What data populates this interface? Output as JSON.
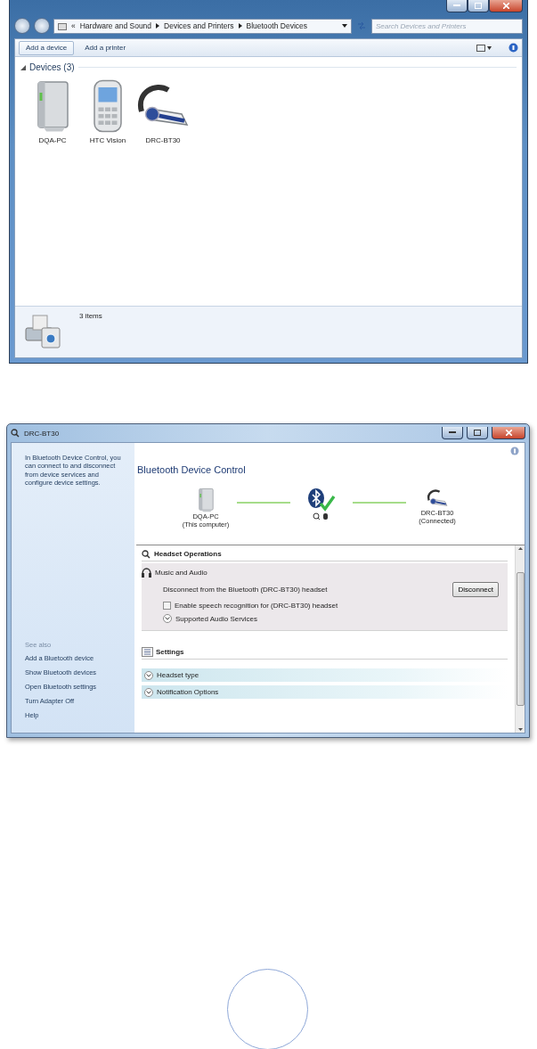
{
  "explorer": {
    "overflow": "«",
    "breadcrumb": [
      "Hardware and Sound",
      "Devices and Printers",
      "Bluetooth Devices"
    ],
    "search": {
      "placeholder": "Search Devices and Printers"
    },
    "toolbar": [
      {
        "label": "Add a device",
        "highlighted": true
      },
      {
        "label": "Add a printer",
        "highlighted": false
      }
    ],
    "group": {
      "label": "Devices (3)",
      "expanded": true
    },
    "devices": [
      {
        "name": "DQA-PC",
        "kind": "computer"
      },
      {
        "name": "HTC Vision",
        "kind": "phone"
      },
      {
        "name": "DRC-BT30",
        "kind": "headset"
      }
    ],
    "status": "3 items"
  },
  "control": {
    "title": "DRC-BT30",
    "intro": "In Bluetooth Device Control, you can connect to and disconnect from device services and configure device settings.",
    "see_also": "See also",
    "links": [
      "Add a Bluetooth device",
      "Show Bluetooth devices",
      "Open Bluetooth settings",
      "Turn Adapter Off",
      "Help"
    ],
    "heading": "Bluetooth Device Control",
    "computer": {
      "name": "DQA-PC",
      "note": "(This computer)"
    },
    "remote": {
      "name": "DRC-BT30",
      "note": "(Connected)"
    },
    "operations": {
      "title": "Headset Operations",
      "service": "Music and Audio",
      "action_text": "Disconnect from the Bluetooth (DRC-BT30) headset",
      "button": "Disconnect",
      "speech": {
        "label": "Enable speech recognition for (DRC-BT30) headset",
        "checked": false
      },
      "supported": "Supported Audio Services"
    },
    "settings": {
      "title": "Settings",
      "sections": [
        {
          "label": "Headset type"
        },
        {
          "label": "Notification Options"
        }
      ]
    }
  }
}
